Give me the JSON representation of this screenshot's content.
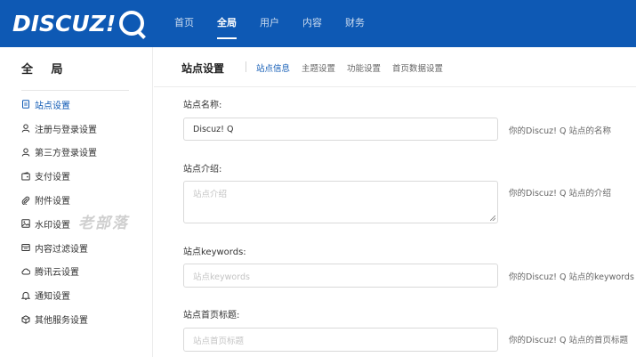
{
  "brand": {
    "logo_text": "DISCUZ!",
    "accent_color": "#0e59b4"
  },
  "nav": {
    "items": [
      {
        "label": "首页"
      },
      {
        "label": "全局",
        "active": true
      },
      {
        "label": "用户"
      },
      {
        "label": "内容"
      },
      {
        "label": "财务"
      }
    ]
  },
  "sidebar": {
    "title": "全 局",
    "items": [
      {
        "label": "站点设置",
        "icon": "document-icon",
        "active": true
      },
      {
        "label": "注册与登录设置",
        "icon": "user-icon"
      },
      {
        "label": "第三方登录设置",
        "icon": "user-icon"
      },
      {
        "label": "支付设置",
        "icon": "wallet-icon"
      },
      {
        "label": "附件设置",
        "icon": "paperclip-icon"
      },
      {
        "label": "水印设置",
        "icon": "image-icon"
      },
      {
        "label": "内容过滤设置",
        "icon": "filter-icon"
      },
      {
        "label": "腾讯云设置",
        "icon": "cloud-icon"
      },
      {
        "label": "通知设置",
        "icon": "bell-icon"
      },
      {
        "label": "其他服务设置",
        "icon": "cube-icon"
      }
    ],
    "watermark": "老部落"
  },
  "main": {
    "title": "站点设置",
    "tabs": [
      {
        "label": "站点信息",
        "active": true
      },
      {
        "label": "主题设置"
      },
      {
        "label": "功能设置"
      },
      {
        "label": "首页数据设置"
      }
    ],
    "fields": [
      {
        "label": "站点名称:",
        "value": "Discuz! Q",
        "placeholder": "",
        "hint": "你的Discuz! Q 站点的名称"
      },
      {
        "label": "站点介绍:",
        "value": "",
        "placeholder": "站点介绍",
        "hint": "你的Discuz! Q 站点的介绍"
      },
      {
        "label": "站点keywords:",
        "value": "",
        "placeholder": "站点keywords",
        "hint": "你的Discuz! Q 站点的keywords"
      },
      {
        "label": "站点首页标题:",
        "value": "",
        "placeholder": "站点首页标题",
        "hint": "你的Discuz! Q 站点的首页标题"
      }
    ]
  }
}
